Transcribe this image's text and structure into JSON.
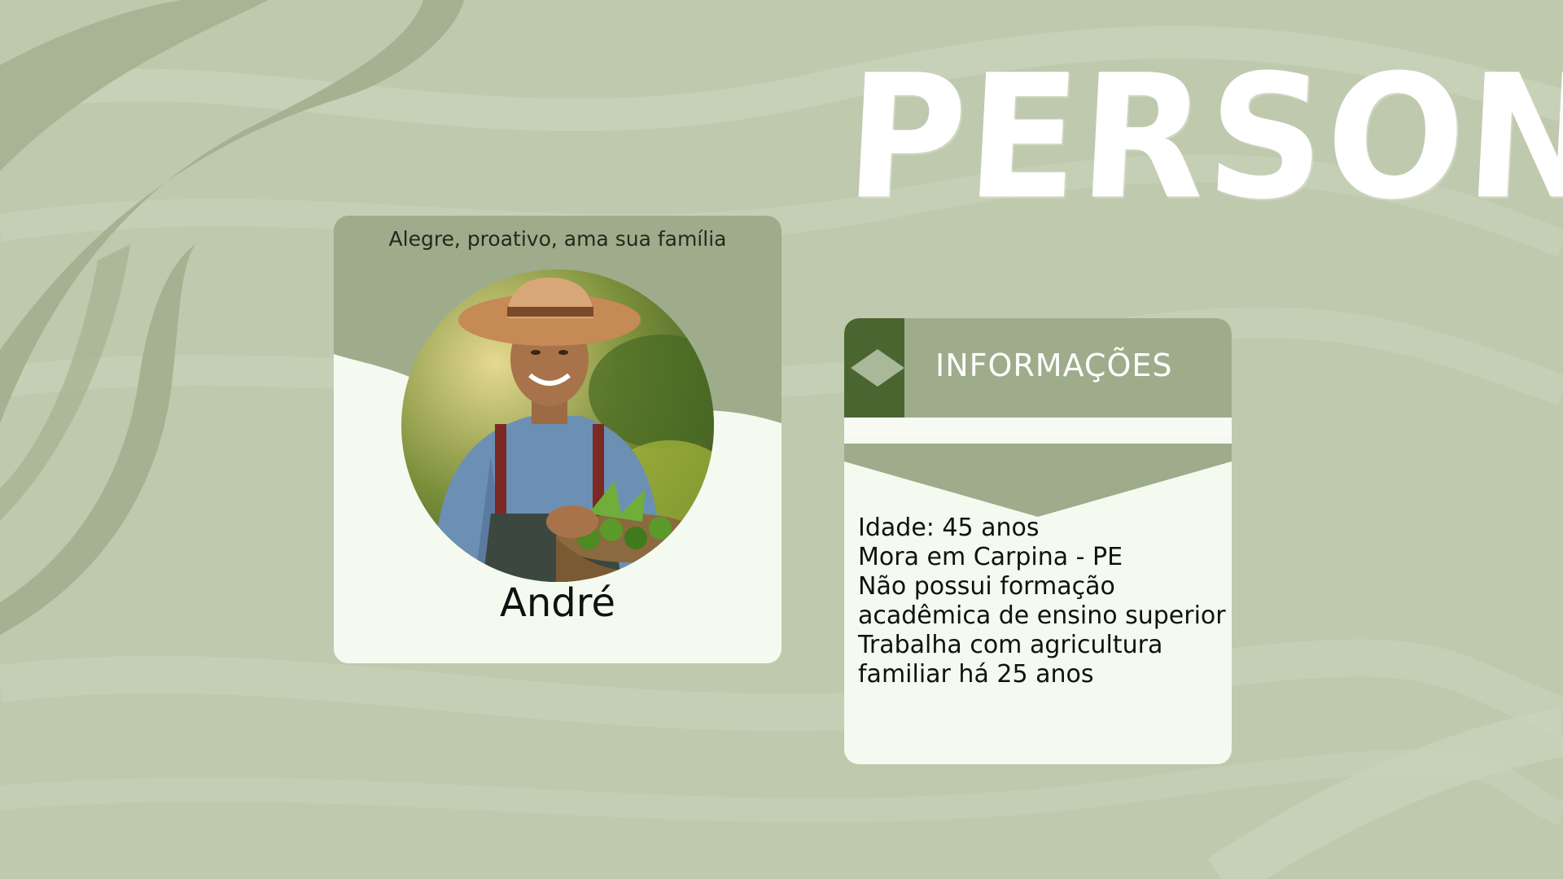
{
  "slide": {
    "title": "PERSONA",
    "colors": {
      "background": "#bfc9ad",
      "accent_dark": "#4b6531",
      "accent_mid": "#9eac8c",
      "card_bg": "#f4faef",
      "title_color": "#ffffff"
    }
  },
  "persona_card": {
    "traits": "Alegre, proativo, ama sua família",
    "name": "André",
    "photo_icon": "farmer-photo"
  },
  "info_card": {
    "header_icon": "diamond-icon",
    "title": "INFORMAÇÕES",
    "lines": [
      "Idade: 45 anos",
      "Mora em Carpina - PE",
      "Não possui formação",
      "acadêmica de ensino superior",
      "Trabalha com agricultura",
      "familiar há 25 anos"
    ]
  }
}
